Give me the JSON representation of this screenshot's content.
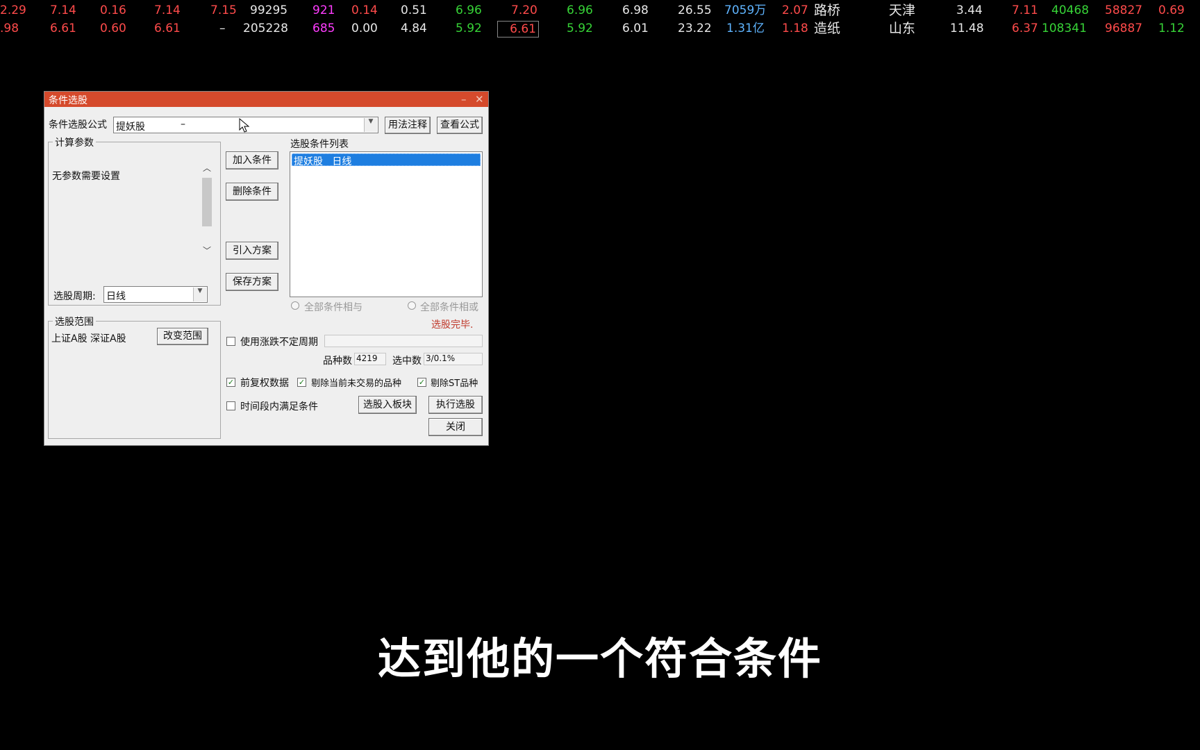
{
  "ticker_rows": [
    [
      "2.29",
      "7.14",
      "0.16",
      "7.14",
      "7.15",
      "99295",
      "921",
      "0.14",
      "0.51",
      "6.96",
      "7.20",
      "6.96",
      "6.98",
      "26.55",
      "7059万",
      "2.07",
      "路桥",
      "天津",
      "3.44",
      "7.11",
      "40468",
      "58827",
      "0.69"
    ],
    [
      ".98",
      "6.61",
      "0.60",
      "6.61",
      "–",
      "205228",
      "685",
      "0.00",
      "4.84",
      "5.92",
      "6.61",
      "5.92",
      "6.01",
      "23.22",
      "1.31亿",
      "1.18",
      "造纸",
      "山东",
      "11.48",
      "6.37",
      "108341",
      "96887",
      "1.12"
    ]
  ],
  "dialog": {
    "title": "条件选股",
    "formula_label": "条件选股公式",
    "formula_value": "提妖股",
    "formula_dash": "–",
    "usage_button": "用法注释",
    "view_formula_button": "查看公式",
    "params_legend": "计算参数",
    "params_text": "无参数需要设置",
    "period_label": "选股周期:",
    "period_value": "日线",
    "scope_legend": "选股范围",
    "scope_text": "上证A股  深证A股",
    "change_scope_button": "改变范围",
    "add_condition_button": "加入条件",
    "delete_condition_button": "删除条件",
    "import_plan_button": "引入方案",
    "save_plan_button": "保存方案",
    "conditions_list_label": "选股条件列表",
    "conditions": [
      "提妖股   日线"
    ],
    "radio_and": "全部条件相与",
    "radio_or": "全部条件相或",
    "status_text": "选股完毕.",
    "use_variable_period": "使用涨跌不定周期",
    "count_label": "品种数",
    "count_value": "4219",
    "selected_label": "选中数",
    "selected_value": "3/0.1%",
    "adjusted_data": "前复权数据",
    "exclude_untraded": "剔除当前未交易的品种",
    "exclude_st": "剔除ST品种",
    "time_range": "时间段内满足条件",
    "to_block_button": "选股入板块",
    "execute_button": "执行选股",
    "close_button": "关闭",
    "check_mark": "✓"
  },
  "subtitle": "达到他的一个符合条件",
  "colors": {
    "title_bar": "#d54a2c",
    "selection": "#1e7ee0",
    "status": "#c0392b"
  }
}
